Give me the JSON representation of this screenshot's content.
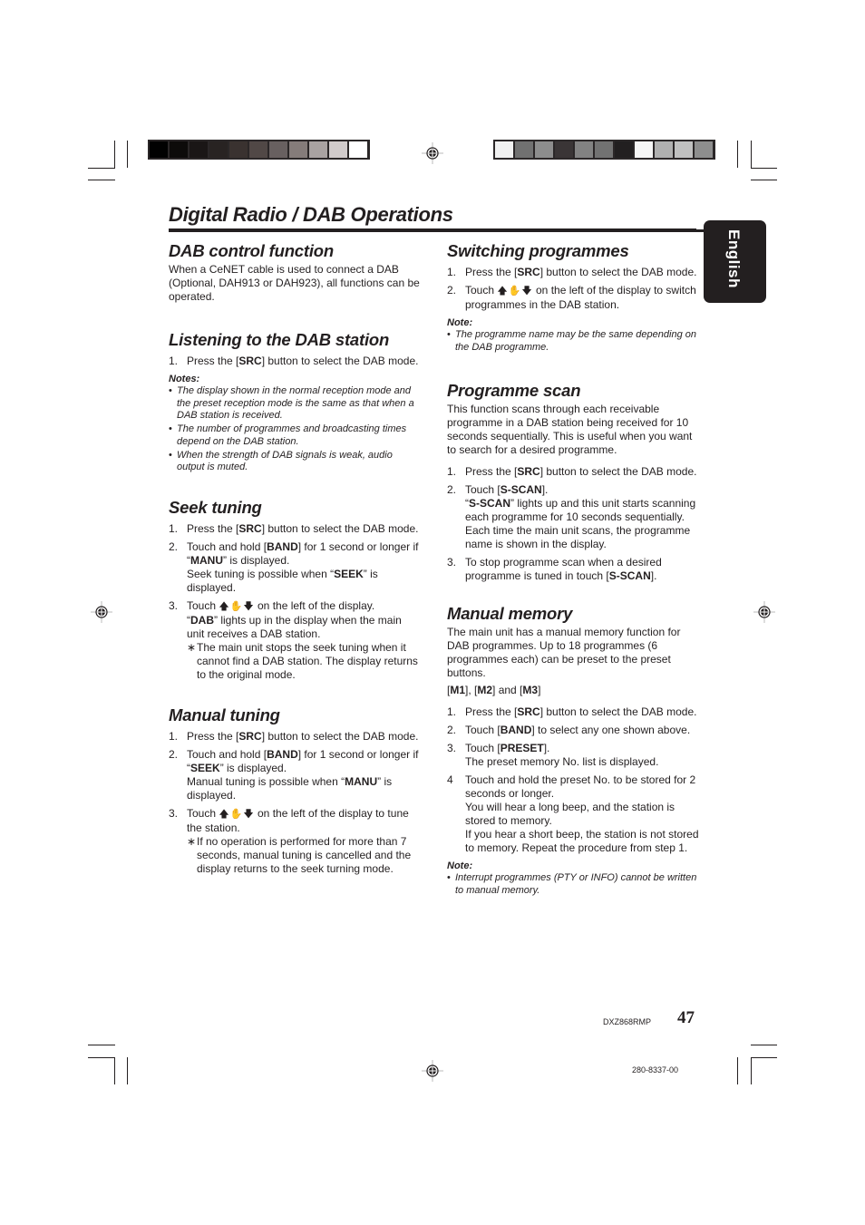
{
  "title": "Digital Radio / DAB Operations",
  "language_tab": "English",
  "colors": {
    "ink": "#231f20",
    "bar_left": [
      "#010101",
      "#0d0b0a",
      "#1a1616",
      "#282322",
      "#3a3230",
      "#514846",
      "#686060",
      "#857c7a",
      "#a9a2a1",
      "#d1cbcb",
      "#ffffff"
    ],
    "bar_right": [
      "#f1f1f1",
      "#717171",
      "#8d8d8d",
      "#3a3536",
      "#828282",
      "#727272",
      "#221f20",
      "#f6f6f6",
      "#b0b0b0",
      "#c0c0c0",
      "#8e8e8e"
    ]
  },
  "icons": {
    "registration_mark": "registration-mark-icon",
    "tune_controls": "up-hand-down-icon"
  },
  "sections": {
    "dab_control": {
      "heading": "DAB control function",
      "body": "When a CeNET cable is used to connect a DAB (Optional, DAH913 or DAH923), all functions can be operated."
    },
    "listening": {
      "heading": "Listening to the DAB station",
      "steps": [
        {
          "num": "1.",
          "pre": "Press the [",
          "bold": "SRC",
          "post": "] button to select the DAB mode."
        }
      ],
      "notes_heading": "Notes:",
      "notes": [
        "The display shown in the normal reception mode and the preset reception mode is the same as that when a DAB station is received.",
        "The number of programmes and broadcasting times depend on the DAB station.",
        "When the strength of DAB signals is weak, audio output is muted."
      ]
    },
    "seek": {
      "heading": "Seek tuning",
      "step1": {
        "num": "1.",
        "pre": "Press the [",
        "bold": "SRC",
        "post": "] button to select the DAB mode."
      },
      "step2": {
        "num": "2.",
        "a": "Touch and hold [",
        "b": "BAND",
        "c": "] for 1 second or longer if “",
        "d": "MANU",
        "e": "” is displayed.",
        "f": "Seek tuning is possible when “",
        "g": "SEEK",
        "h": "” is displayed."
      },
      "step3": {
        "num": "3.",
        "a": "Touch ",
        "b": " on the left of the display.",
        "c": "“",
        "d": "DAB",
        "e": "” lights up in the display when the main unit receives a DAB station.",
        "sub": "The main unit stops the seek tuning when it cannot find a DAB station. The display returns to the original mode."
      }
    },
    "manual_tuning": {
      "heading": "Manual tuning",
      "step1": {
        "num": "1.",
        "pre": "Press the [",
        "bold": "SRC",
        "post": "] button to select the DAB mode."
      },
      "step2": {
        "num": "2.",
        "a": "Touch and hold [",
        "b": "BAND",
        "c": "] for 1 second or longer if “",
        "d": "SEEK",
        "e": "” is displayed.",
        "f": "Manual tuning is possible when “",
        "g": "MANU",
        "h": "” is displayed."
      },
      "step3": {
        "num": "3.",
        "a": "Touch ",
        "b": " on the left of the display to tune the station.",
        "sub": "If no operation is performed for more than 7 seconds, manual tuning is cancelled and the display returns to the seek turning mode."
      }
    },
    "switching": {
      "heading": "Switching programmes",
      "step1": {
        "num": "1.",
        "pre": "Press the [",
        "bold": "SRC",
        "post": "] button to select the DAB mode."
      },
      "step2": {
        "num": "2.",
        "a": "Touch ",
        "b": " on the left of the display to switch programmes in the DAB station."
      },
      "note_heading": "Note:",
      "notes": [
        "The programme name may be the same depending on the DAB programme."
      ]
    },
    "scan": {
      "heading": "Programme scan",
      "body": "This function scans through each receivable programme in a DAB station being received for 10 seconds sequentially. This is useful when you want to search for a desired programme.",
      "step1": {
        "num": "1.",
        "pre": "Press the [",
        "bold": "SRC",
        "post": "] button to select the DAB mode."
      },
      "step2": {
        "num": "2.",
        "a": "Touch [",
        "b": "S-SCAN",
        "c": "].",
        "d": "“",
        "e": "S-SCAN",
        "f": "” lights up and this unit starts scanning each programme for 10 seconds sequentially.",
        "g": "Each time the main unit scans, the programme name is shown in the display."
      },
      "step3": {
        "num": "3.",
        "a": "To stop programme scan when a desired programme is tuned in touch [",
        "b": "S-SCAN",
        "c": "]."
      }
    },
    "memory": {
      "heading": "Manual memory",
      "body": "The main unit has a manual memory function for DAB programmes. Up to 18 programmes (6 programmes each) can be preset to the preset buttons.",
      "bands": {
        "m1": "M1",
        "m2": "M2",
        "m3": "M3",
        "sep1": "], [",
        "sep2": "] and [",
        "open": "[",
        "close": "]"
      },
      "step1": {
        "num": "1.",
        "pre": "Press the [",
        "bold": "SRC",
        "post": "] button to select the DAB mode."
      },
      "step2": {
        "num": "2.",
        "pre": "Touch [",
        "bold": "BAND",
        "post": "] to select any one shown above."
      },
      "step3": {
        "num": "3.",
        "pre": "Touch [",
        "bold": "PRESET",
        "post": "].",
        "line2": "The preset memory No. list is displayed."
      },
      "step4": {
        "num": "4",
        "a": "Touch and hold the preset No. to be stored for 2 seconds or longer.",
        "b": "You will hear a long beep, and the station is stored to memory.",
        "c": "If you hear a short beep, the station is not stored to memory. Repeat the procedure from step 1."
      },
      "note_heading": "Note:",
      "notes": [
        "Interrupt programmes (PTY or INFO) cannot be written to manual memory."
      ]
    }
  },
  "footer": {
    "model": "DXZ868RMP",
    "page_number": "47",
    "part_number": "280-8337-00"
  }
}
